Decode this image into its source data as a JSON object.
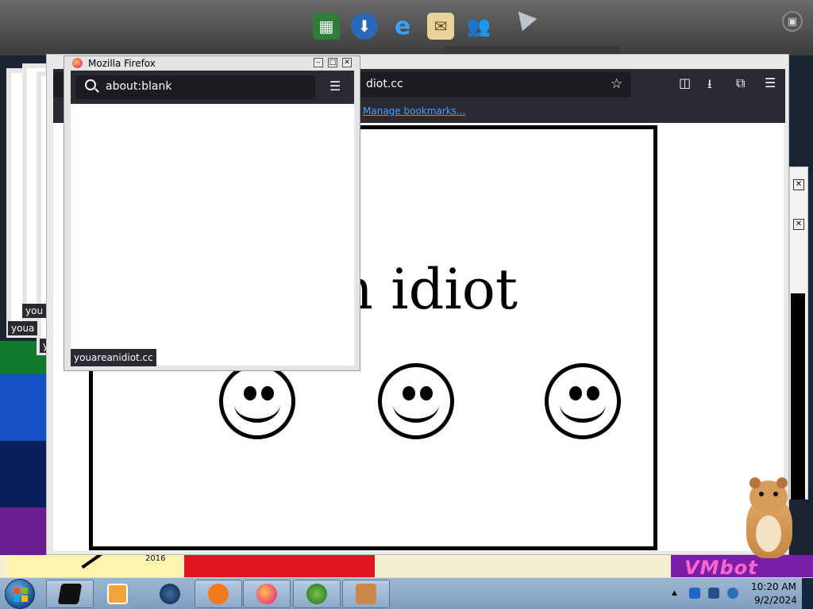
{
  "main_window": {
    "url_fragment": "diot.cc",
    "manage_bookmarks": "Manage bookmarks...",
    "page_text": "re an idiot"
  },
  "small_window": {
    "title": "Mozilla Firefox",
    "url": "about:blank",
    "status": "youareanidiot.cc"
  },
  "ghost_tags": [
    "youa",
    "you",
    "youa",
    "yo"
  ],
  "wallpaper": {
    "year": "2016",
    "brand": "VMbot"
  },
  "dock": {
    "icons": [
      "spreadsheet-icon",
      "globe-download-icon",
      "internet-explorer-icon",
      "mail-icon",
      "users-icon"
    ]
  },
  "taskbar": {
    "items": [
      "media-player-icon",
      "blue-globe-icon",
      "avast-icon",
      "firefox-icon",
      "windows-orb-icon",
      "toolkit-icon"
    ],
    "clock_time": "10:20 AM",
    "clock_date": "9/2/2024"
  },
  "colors": {
    "firefox_toolbar": "#2b2a33",
    "firefox_urlbar": "#1c1b22",
    "link": "#45a1ff",
    "taskbar": "#9db7d2"
  }
}
